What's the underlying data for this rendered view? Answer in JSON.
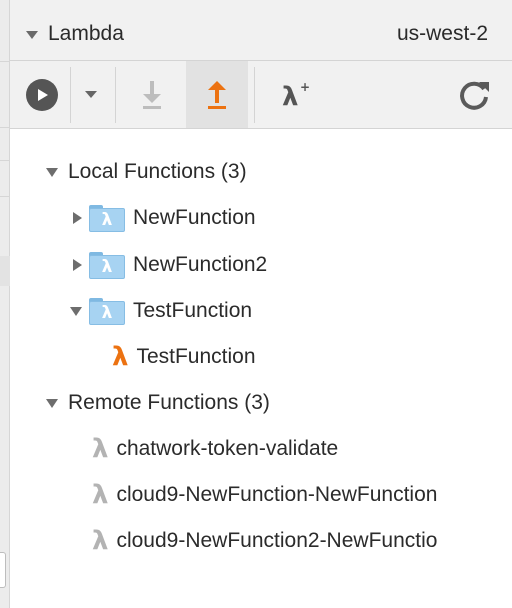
{
  "panel": {
    "title": "Lambda",
    "region": "us-west-2"
  },
  "toolbar": {
    "run_icon": "play-icon",
    "run_dropdown_icon": "chevron-down-icon",
    "import_icon": "download-icon",
    "deploy_icon": "upload-icon",
    "create_icon": "lambda-plus-icon",
    "refresh_icon": "refresh-icon",
    "deploy_color": "#ec7211"
  },
  "tree": {
    "local": {
      "label": "Local Functions (3)",
      "items": [
        {
          "label": "NewFunction",
          "glyph": "λ",
          "expanded": false
        },
        {
          "label": "NewFunction2",
          "glyph": "λ",
          "expanded": false
        },
        {
          "label": "TestFunction",
          "glyph": "λ",
          "expanded": true,
          "children": [
            {
              "label": "TestFunction",
              "glyph": "λ"
            }
          ]
        }
      ]
    },
    "remote": {
      "label": "Remote Functions (3)",
      "items": [
        {
          "label": "chatwork-token-validate",
          "glyph": "λ"
        },
        {
          "label": "cloud9-NewFunction-NewFunction",
          "glyph": "λ"
        },
        {
          "label": "cloud9-NewFunction2-NewFunctio",
          "glyph": "λ"
        }
      ]
    }
  },
  "colors": {
    "lambda_local": "#ec7211",
    "lambda_remote": "#b3b3b3",
    "folder": "#a7d3f2",
    "panel_bg": "#f1f1f1"
  }
}
